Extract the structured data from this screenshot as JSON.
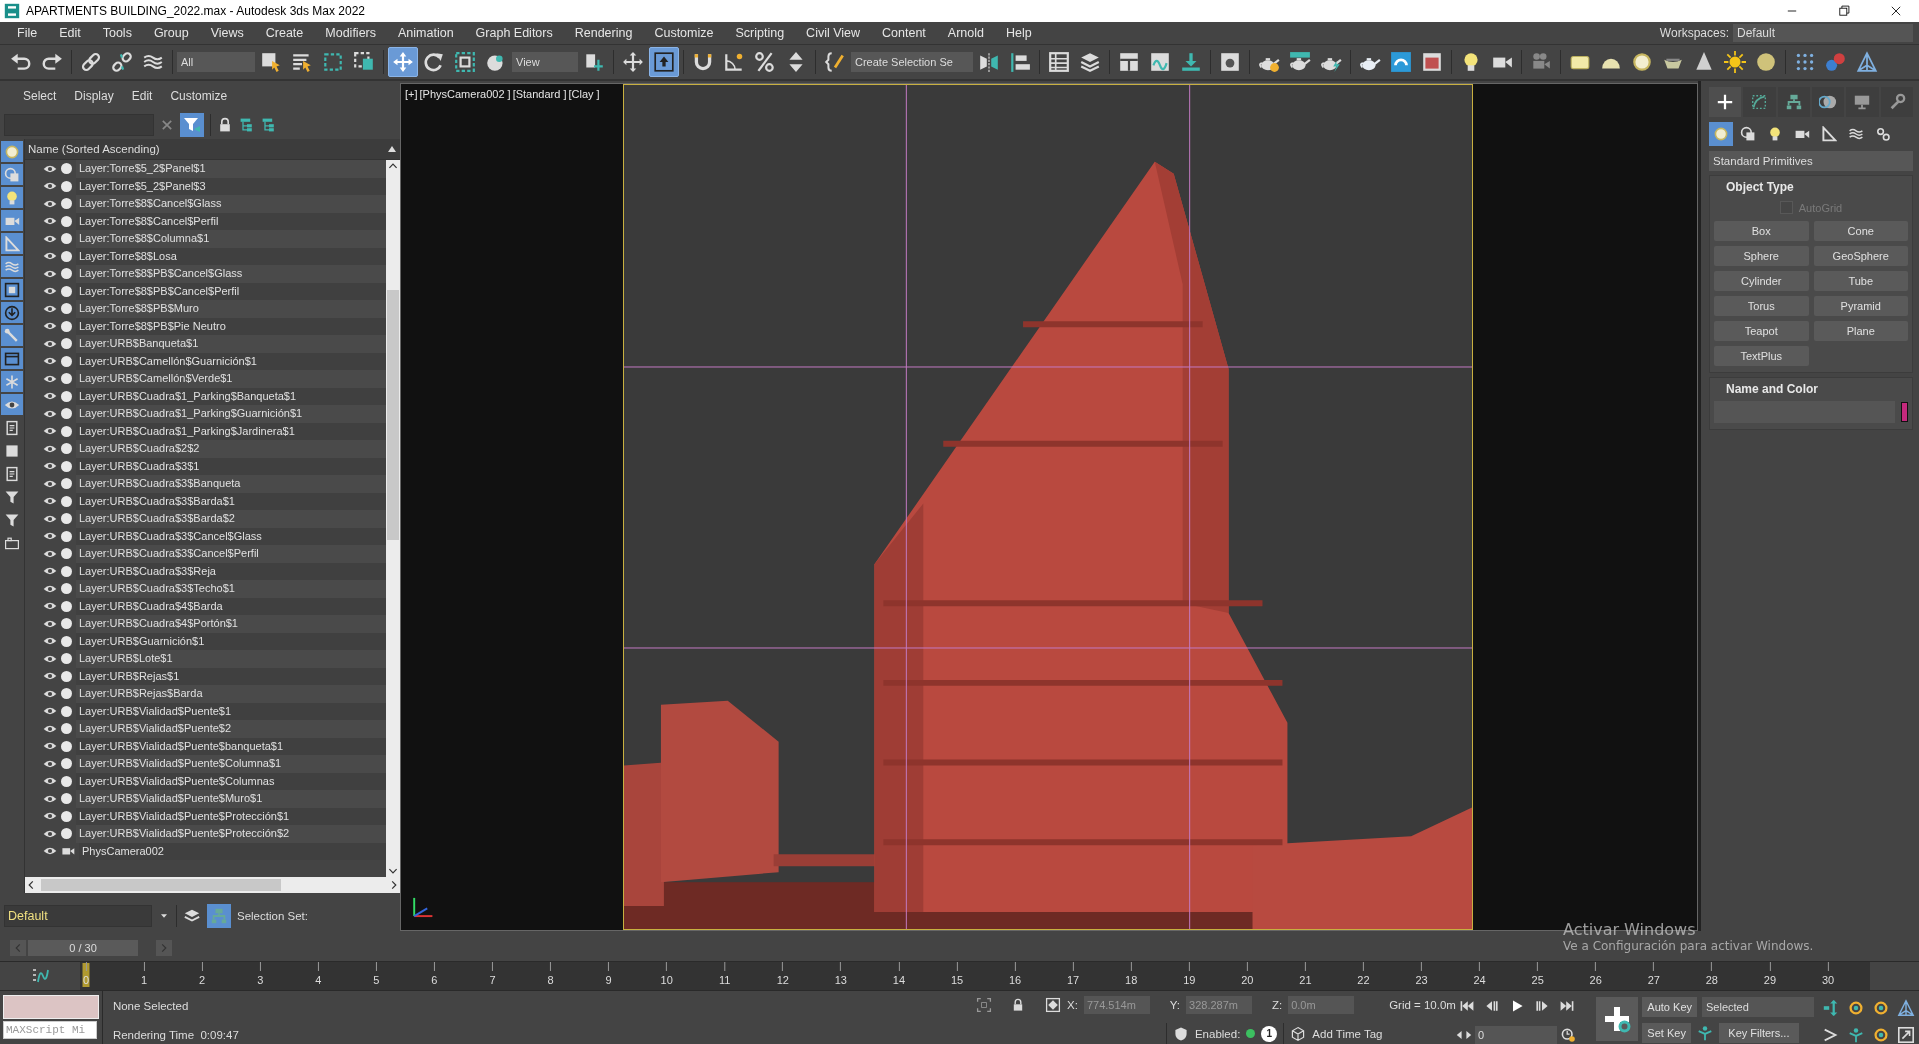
{
  "window": {
    "title": "APARTMENTS BUILDING_2022.max - Autodesk 3ds Max 2022"
  },
  "menu": [
    "File",
    "Edit",
    "Tools",
    "Group",
    "Views",
    "Create",
    "Modifiers",
    "Animation",
    "Graph Editors",
    "Rendering",
    "Customize",
    "Scripting",
    "Civil View",
    "Content",
    "Arnold",
    "Help"
  ],
  "workspaces": {
    "label": "Workspaces:",
    "value": "Default"
  },
  "toolbar": [
    {
      "kind": "button",
      "selected": false
    },
    {
      "kind": "button",
      "selected": false
    },
    {
      "kind": "separator"
    },
    {
      "kind": "button",
      "selected": false
    },
    {
      "kind": "button",
      "selected": false
    },
    {
      "kind": "button",
      "selected": false
    },
    {
      "kind": "separator"
    },
    {
      "kind": "dropdown",
      "value": "All"
    },
    {
      "kind": "button",
      "selected": false
    },
    {
      "kind": "button",
      "selected": false
    },
    {
      "kind": "button",
      "selected": false
    },
    {
      "kind": "button",
      "selected": false
    },
    {
      "kind": "separator"
    },
    {
      "kind": "button",
      "selected": true
    },
    {
      "kind": "button",
      "selected": false
    },
    {
      "kind": "button",
      "selected": false
    },
    {
      "kind": "button",
      "selected": false
    },
    {
      "kind": "dropdown",
      "value": "View"
    },
    {
      "kind": "button",
      "selected": false
    },
    {
      "kind": "separator"
    },
    {
      "kind": "button",
      "selected": false
    },
    {
      "kind": "button",
      "selected": true
    },
    {
      "kind": "separator"
    },
    {
      "kind": "button",
      "selected": false
    },
    {
      "kind": "button",
      "selected": false
    },
    {
      "kind": "button",
      "selected": false
    },
    {
      "kind": "button",
      "selected": false
    },
    {
      "kind": "separator"
    },
    {
      "kind": "button",
      "selected": false
    },
    {
      "kind": "field",
      "value": "Create Selection Se"
    },
    {
      "kind": "button",
      "selected": false
    },
    {
      "kind": "button",
      "selected": false
    },
    {
      "kind": "separator"
    },
    {
      "kind": "button",
      "selected": false
    },
    {
      "kind": "button",
      "selected": false
    },
    {
      "kind": "separator"
    },
    {
      "kind": "button",
      "selected": false
    },
    {
      "kind": "button",
      "selected": false
    },
    {
      "kind": "button",
      "selected": false
    },
    {
      "kind": "separator"
    },
    {
      "kind": "button",
      "selected": false
    },
    {
      "kind": "separator"
    },
    {
      "kind": "button",
      "selected": false
    },
    {
      "kind": "button",
      "selected": false
    },
    {
      "kind": "button",
      "selected": false
    },
    {
      "kind": "separator"
    },
    {
      "kind": "button",
      "selected": false
    },
    {
      "kind": "button",
      "selected": false
    },
    {
      "kind": "button",
      "selected": false
    },
    {
      "kind": "separator"
    },
    {
      "kind": "button",
      "selected": false
    },
    {
      "kind": "button",
      "selected": false
    },
    {
      "kind": "separator"
    },
    {
      "kind": "button",
      "selected": false
    },
    {
      "kind": "separator"
    },
    {
      "kind": "button",
      "selected": false
    },
    {
      "kind": "button",
      "selected": false
    },
    {
      "kind": "button",
      "selected": false
    },
    {
      "kind": "button",
      "selected": false
    },
    {
      "kind": "button",
      "selected": false
    },
    {
      "kind": "button",
      "selected": false
    },
    {
      "kind": "button",
      "selected": false
    },
    {
      "kind": "separator"
    },
    {
      "kind": "button",
      "selected": false
    },
    {
      "kind": "button",
      "selected": false
    },
    {
      "kind": "button",
      "selected": false
    }
  ],
  "scene_explorer": {
    "tabs": [
      "Select",
      "Display",
      "Edit",
      "Customize"
    ],
    "filter_button": {
      "selected": true
    },
    "column_header": "Name (Sorted Ascending)",
    "filters": [
      {
        "selected": true
      },
      {
        "selected": true
      },
      {
        "selected": true
      },
      {
        "selected": true
      },
      {
        "selected": true
      },
      {
        "selected": true
      },
      {
        "selected": true
      },
      {
        "selected": true
      },
      {
        "selected": true
      },
      {
        "selected": true
      },
      {
        "selected": true
      },
      {
        "selected": true
      },
      {
        "selected": false
      },
      {
        "selected": false
      },
      {
        "selected": false
      },
      {
        "selected": false
      },
      {
        "selected": false
      },
      {
        "selected": false
      }
    ],
    "rows": [
      {
        "kind": "layer",
        "name": "Layer:Torre$5_2$Panel$1"
      },
      {
        "kind": "layer",
        "name": "Layer:Torre$5_2$Panel$3"
      },
      {
        "kind": "layer",
        "name": "Layer:Torre$8$Cancel$Glass"
      },
      {
        "kind": "layer",
        "name": "Layer:Torre$8$Cancel$Perfil"
      },
      {
        "kind": "layer",
        "name": "Layer:Torre$8$Columna$1"
      },
      {
        "kind": "layer",
        "name": "Layer:Torre$8$Losa"
      },
      {
        "kind": "layer",
        "name": "Layer:Torre$8$PB$Cancel$Glass"
      },
      {
        "kind": "layer",
        "name": "Layer:Torre$8$PB$Cancel$Perfil"
      },
      {
        "kind": "layer",
        "name": "Layer:Torre$8$PB$Muro"
      },
      {
        "kind": "layer",
        "name": "Layer:Torre$8$PB$Pie Neutro"
      },
      {
        "kind": "layer",
        "name": "Layer:URB$Banqueta$1"
      },
      {
        "kind": "layer",
        "name": "Layer:URB$Camellón$Guarnición$1"
      },
      {
        "kind": "layer",
        "name": "Layer:URB$Camellón$Verde$1"
      },
      {
        "kind": "layer",
        "name": "Layer:URB$Cuadra$1_Parking$Banqueta$1"
      },
      {
        "kind": "layer",
        "name": "Layer:URB$Cuadra$1_Parking$Guarnición$1"
      },
      {
        "kind": "layer",
        "name": "Layer:URB$Cuadra$1_Parking$Jardinera$1"
      },
      {
        "kind": "layer",
        "name": "Layer:URB$Cuadra$2$2"
      },
      {
        "kind": "layer",
        "name": "Layer:URB$Cuadra$3$1"
      },
      {
        "kind": "layer",
        "name": "Layer:URB$Cuadra$3$Banqueta"
      },
      {
        "kind": "layer",
        "name": "Layer:URB$Cuadra$3$Barda$1"
      },
      {
        "kind": "layer",
        "name": "Layer:URB$Cuadra$3$Barda$2"
      },
      {
        "kind": "layer",
        "name": "Layer:URB$Cuadra$3$Cancel$Glass"
      },
      {
        "kind": "layer",
        "name": "Layer:URB$Cuadra$3$Cancel$Perfil"
      },
      {
        "kind": "layer",
        "name": "Layer:URB$Cuadra$3$Reja"
      },
      {
        "kind": "layer",
        "name": "Layer:URB$Cuadra$3$Techo$1"
      },
      {
        "kind": "layer",
        "name": "Layer:URB$Cuadra$4$Barda"
      },
      {
        "kind": "layer",
        "name": "Layer:URB$Cuadra$4$Portón$1"
      },
      {
        "kind": "layer",
        "name": "Layer:URB$Guarnición$1"
      },
      {
        "kind": "layer",
        "name": "Layer:URB$Lote$1"
      },
      {
        "kind": "layer",
        "name": "Layer:URB$Rejas$1"
      },
      {
        "kind": "layer",
        "name": "Layer:URB$Rejas$Barda"
      },
      {
        "kind": "layer",
        "name": "Layer:URB$Vialidad$Puente$1"
      },
      {
        "kind": "layer",
        "name": "Layer:URB$Vialidad$Puente$2"
      },
      {
        "kind": "layer",
        "name": "Layer:URB$Vialidad$Puente$banqueta$1"
      },
      {
        "kind": "layer",
        "name": "Layer:URB$Vialidad$Puente$Columna$1"
      },
      {
        "kind": "layer",
        "name": "Layer:URB$Vialidad$Puente$Columnas"
      },
      {
        "kind": "layer",
        "name": "Layer:URB$Vialidad$Puente$Muro$1"
      },
      {
        "kind": "layer",
        "name": "Layer:URB$Vialidad$Puente$Protección$1"
      },
      {
        "kind": "layer",
        "name": "Layer:URB$Vialidad$Puente$Protección$2"
      },
      {
        "kind": "camera",
        "name": "PhysCamera002"
      }
    ]
  },
  "layer_bar": {
    "layer": "Default",
    "hierarchy_selected": true,
    "label": "Selection Set:"
  },
  "viewport": {
    "labels": [
      "[+]",
      "[PhysCamera002 ]",
      "[Standard ]",
      "[Clay ]"
    ]
  },
  "command_panel": {
    "tabs": [
      {
        "selected": true
      },
      {
        "selected": false
      },
      {
        "selected": false
      },
      {
        "selected": false
      },
      {
        "selected": false
      },
      {
        "selected": false
      }
    ],
    "categories": [
      {
        "selected": true
      },
      {
        "selected": false
      },
      {
        "selected": false
      },
      {
        "selected": false
      },
      {
        "selected": false
      },
      {
        "selected": false
      },
      {
        "selected": false
      }
    ],
    "dropdown": "Standard Primitives",
    "object_type": {
      "title": "Object Type",
      "autogrid": {
        "label": "AutoGrid",
        "checked": false,
        "disabled": true
      },
      "buttons": [
        "Box",
        "Cone",
        "Sphere",
        "GeoSphere",
        "Cylinder",
        "Tube",
        "Torus",
        "Pyramid",
        "Teapot",
        "Plane",
        "TextPlus"
      ]
    },
    "name_and_color": {
      "title": "Name and Color",
      "color": "#c4297c"
    }
  },
  "time_slider": {
    "label": "0 / 30",
    "level": 0
  },
  "timeline": {
    "ticks": [
      "0",
      "1",
      "2",
      "3",
      "4",
      "5",
      "6",
      "7",
      "8",
      "9",
      "10",
      "11",
      "12",
      "13",
      "14",
      "15",
      "16",
      "17",
      "18",
      "19",
      "20",
      "21",
      "22",
      "23",
      "24",
      "25",
      "26",
      "27",
      "28",
      "29",
      "30"
    ]
  },
  "status": {
    "listener_placeholder": "MAXScript Mi",
    "selection": "None Selected",
    "render_time": "Rendering Time  0:09:47",
    "x_label": "X:",
    "x": "774.514m",
    "y_label": "Y:",
    "y": "328.287m",
    "z_label": "Z:",
    "z": "0.0m",
    "grid": "Grid = 10.0m",
    "enabled_label": "Enabled:",
    "enabled": true,
    "badge": "1",
    "time_tag": "Add Time Tag",
    "frame": "0",
    "auto_key": "Auto Key",
    "set_key": "Set Key",
    "key_mode": "Selected",
    "key_filters": "Key Filters..."
  },
  "os_notice": {
    "title": "Activar Windows",
    "text": "Ve a Configuración para activar Windows."
  }
}
